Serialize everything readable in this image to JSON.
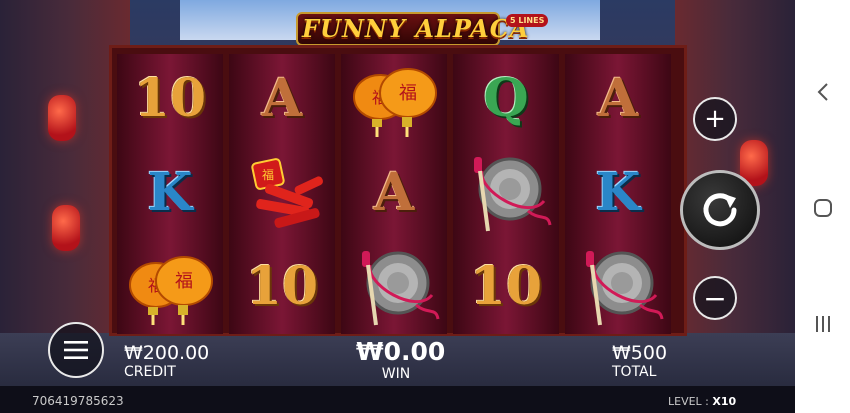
{
  "game": {
    "title": "FUNNY ALPACA",
    "lines_badge": "5 LINES",
    "reels": [
      [
        "10",
        "K",
        "lantern"
      ],
      [
        "A",
        "firecracker",
        "10"
      ],
      [
        "lantern",
        "A",
        "gong"
      ],
      [
        "Q",
        "gong",
        "10"
      ],
      [
        "A",
        "K",
        "gong"
      ]
    ],
    "credit": {
      "value": "₩200.00",
      "label": "CREDIT"
    },
    "win": {
      "value": "₩0.00",
      "label": "WIN"
    },
    "total": {
      "value": "₩500",
      "label": "TOTAL"
    },
    "game_id": "706419785623",
    "level": {
      "label": "LEVEL :",
      "value": "X10"
    },
    "buttons": {
      "plus": "plus-icon",
      "minus": "minus-icon",
      "spin": "spin-icon",
      "menu": "menu-icon"
    },
    "colors": {
      "gold": "#ffcf3c",
      "reel_bg": "#7b1635",
      "frame": "#6e1d17"
    }
  },
  "system_nav": {
    "back": "back-icon",
    "home": "home-icon",
    "recents": "recents-icon"
  }
}
